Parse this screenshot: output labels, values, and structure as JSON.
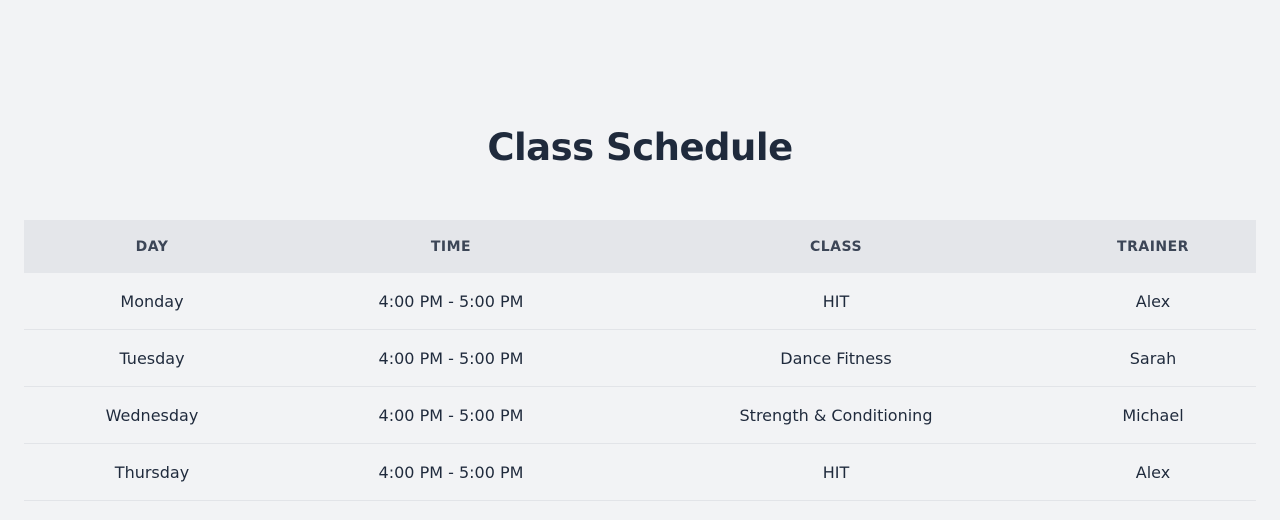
{
  "title": "Class Schedule",
  "table": {
    "headers": [
      "DAY",
      "TIME",
      "CLASS",
      "TRAINER"
    ],
    "rows": [
      {
        "day": "Monday",
        "time": "4:00 PM - 5:00 PM",
        "class": "HIT",
        "trainer": "Alex"
      },
      {
        "day": "Tuesday",
        "time": "4:00 PM - 5:00 PM",
        "class": "Dance Fitness",
        "trainer": "Sarah"
      },
      {
        "day": "Wednesday",
        "time": "4:00 PM - 5:00 PM",
        "class": "Strength & Conditioning",
        "trainer": "Michael"
      },
      {
        "day": "Thursday",
        "time": "4:00 PM - 5:00 PM",
        "class": "HIT",
        "trainer": "Alex"
      }
    ]
  }
}
